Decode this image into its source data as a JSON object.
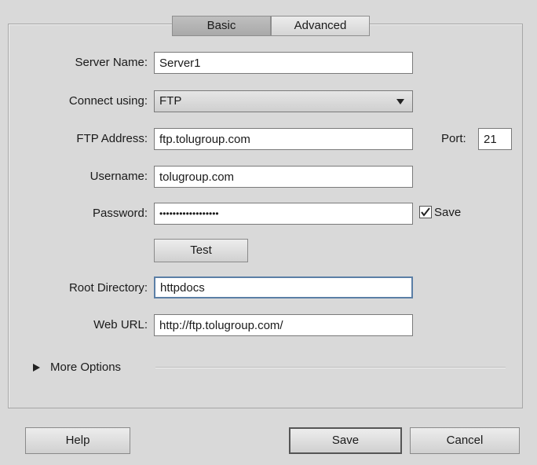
{
  "tabs": {
    "basic": "Basic",
    "advanced": "Advanced"
  },
  "form": {
    "server_name_label": "Server Name:",
    "server_name_value": "Server1",
    "connect_label": "Connect using:",
    "connect_value": "FTP",
    "ftp_address_label": "FTP Address:",
    "ftp_address_value": "ftp.tolugroup.com",
    "port_label": "Port:",
    "port_value": "21",
    "username_label": "Username:",
    "username_value": "tolugroup.com",
    "password_label": "Password:",
    "password_value": "••••••••••••••••••",
    "save_checkbox_label": "Save",
    "test_button": "Test",
    "root_dir_label": "Root Directory:",
    "root_dir_value": "httpdocs",
    "web_url_label": "Web URL:",
    "web_url_value": "http://ftp.tolugroup.com/",
    "more_options_label": "More Options"
  },
  "footer": {
    "help": "Help",
    "save": "Save",
    "cancel": "Cancel"
  },
  "icons": {
    "disclosure": "triangle-right-icon",
    "dropdown": "triangle-down-icon",
    "checkbox": "checkmark-icon"
  }
}
